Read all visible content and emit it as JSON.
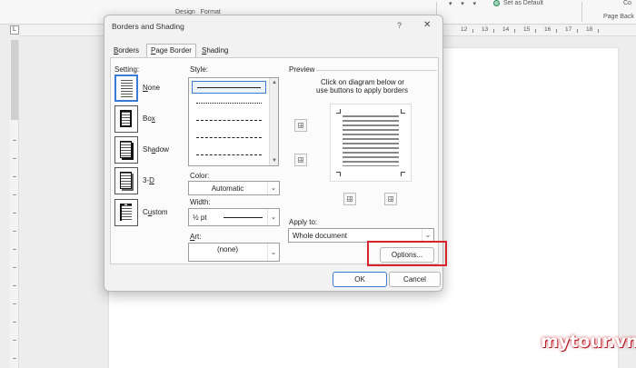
{
  "ribbon": {
    "set_default_label": "Set as Default",
    "page_background_label": "Page Back",
    "top_right_fragment": "Co"
  },
  "ruler": {
    "tab_stop_glyph": "L",
    "numbers": [
      "12",
      "13",
      "14",
      "15",
      "16",
      "17",
      "18"
    ]
  },
  "dialog": {
    "title": "Borders and Shading",
    "help_glyph": "?",
    "close_glyph": "✕",
    "tabs": [
      {
        "label": "Borders",
        "u": "B",
        "active": false
      },
      {
        "label": "Page Border",
        "u": "P",
        "active": true
      },
      {
        "label": "Shading",
        "u": "S",
        "active": false
      }
    ],
    "setting": {
      "label": "Setting:",
      "options": [
        {
          "name": "None",
          "u": "N",
          "selected": true
        },
        {
          "name": "Box",
          "u": "x",
          "selected": false
        },
        {
          "name": "Shadow",
          "u": "A",
          "selected": false
        },
        {
          "name": "3-D",
          "u": "D",
          "selected": false
        },
        {
          "name": "Custom",
          "u": "U",
          "selected": false
        }
      ]
    },
    "style": {
      "label": "Style:",
      "items": [
        "solid",
        "dotted",
        "dashed-small",
        "dashed",
        "dash-dot"
      ]
    },
    "color": {
      "label": "Color:",
      "value": "Automatic"
    },
    "width": {
      "label": "Width:",
      "value": "½ pt"
    },
    "art": {
      "label": "Art:",
      "value": "(none)"
    },
    "preview": {
      "label": "Preview",
      "hint_line1": "Click on diagram below or",
      "hint_line2": "use buttons to apply borders"
    },
    "apply_to": {
      "label": "Apply to:",
      "value": "Whole document"
    },
    "options_label": "Options...",
    "ok_label": "OK",
    "cancel_label": "Cancel"
  },
  "watermark": "mytour.vn",
  "colors": {
    "accent": "#3a7bd5",
    "highlight": "#d8232a",
    "dialog_bg": "#f2f2f2"
  }
}
